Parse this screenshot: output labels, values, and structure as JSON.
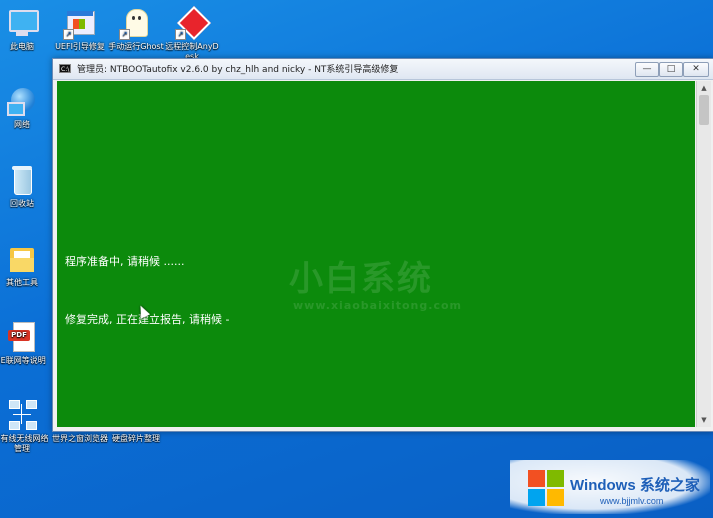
{
  "desktop": {
    "icons": [
      {
        "label": "此电脑"
      },
      {
        "label": "UEFI引导修复"
      },
      {
        "label": "手动运行Ghost"
      },
      {
        "label": "远程控制AnyDesk"
      },
      {
        "label": "网络"
      },
      {
        "label": "回收站"
      },
      {
        "label": "其他工具"
      },
      {
        "label": "IE联网等说明"
      },
      {
        "label": "E有线无线网络管理"
      },
      {
        "label": "世界之窗浏览器"
      },
      {
        "label": "硬盘碎片整理"
      }
    ]
  },
  "window": {
    "title": "管理员: NTBOOTautofix v2.6.0 by chz_hlh and nicky - NT系统引导高级修复",
    "min_symbol": "—",
    "max_symbol": "□",
    "close_symbol": "✕",
    "console_lines": [
      "程序准备中, 请稍候 ......",
      "修复完成, 正在建立报告, 请稍候 -"
    ],
    "watermark_text": "小白系统",
    "watermark_url": "www.xiaobaixitong.com",
    "background_color": "#0c8a0c"
  },
  "brand": {
    "name": "Windows 系统之家",
    "url": "www.bjjmlv.com"
  }
}
